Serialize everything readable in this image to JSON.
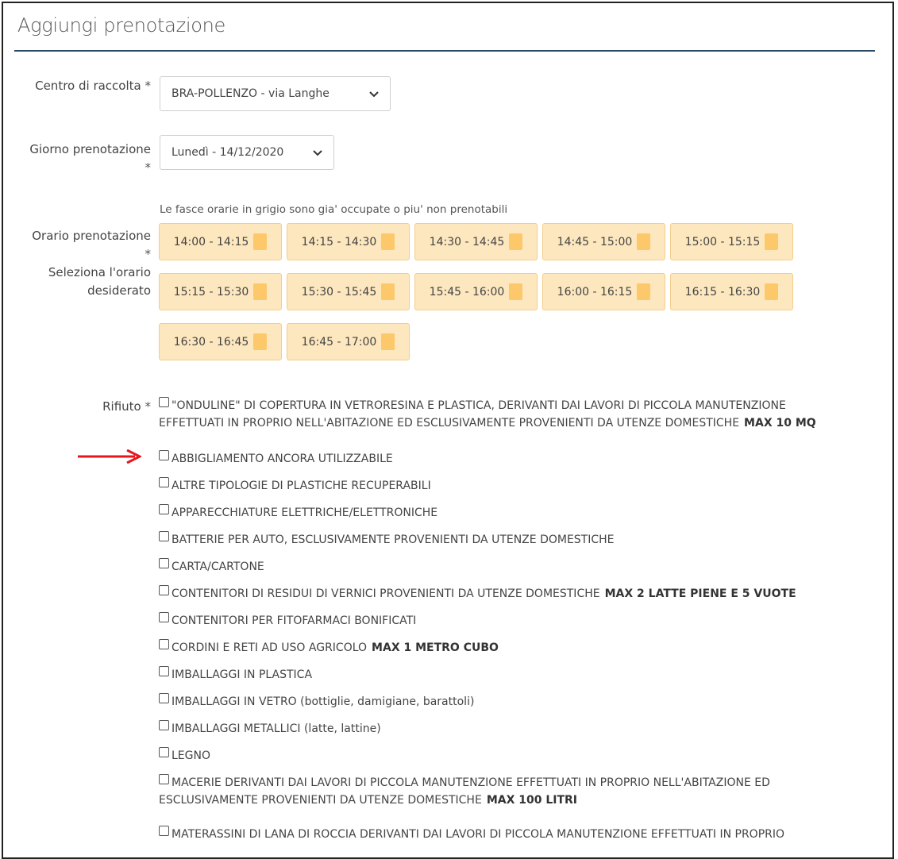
{
  "form": {
    "title": "Aggiungi prenotazione",
    "centro": {
      "label": "Centro di raccolta",
      "required_mark": "*",
      "value": "BRA-POLLENZO - via Langhe"
    },
    "giorno": {
      "label": "Giorno prenotazione",
      "required_mark": "*",
      "value": "Lunedì - 14/12/2020"
    },
    "orario": {
      "label": "Orario prenotazione",
      "required_mark": "*",
      "sublabel_line1": "Seleziona l'orario",
      "sublabel_line2": "desiderato",
      "hint": "Le fasce orarie in grigio sono gia' occupate o piu' non prenotabili",
      "slots": [
        "14:00 - 14:15",
        "14:15 - 14:30",
        "14:30 - 14:45",
        "14:45 - 15:00",
        "15:00 - 15:15",
        "15:15 - 15:30",
        "15:30 - 15:45",
        "15:45 - 16:00",
        "16:00 - 16:15",
        "16:15 - 16:30",
        "16:30 - 16:45",
        "16:45 - 17:00"
      ]
    },
    "rifiuto": {
      "label": "Rifiuto",
      "required_mark": "*",
      "items": [
        {
          "line1": "\"ONDULINE\" DI COPERTURA IN VETRORESINA E PLASTICA, DERIVANTI DAI LAVORI DI PICCOLA MANUTENZIONE",
          "line2": "EFFETTUATI IN PROPRIO NELL'ABITAZIONE ED ESCLUSIVAMENTE PROVENIENTI DA UTENZE DOMESTICHE",
          "max": "MAX 10 MQ"
        },
        {
          "line1": "ABBIGLIAMENTO ANCORA UTILIZZABILE",
          "line2": "",
          "max": ""
        },
        {
          "line1": "ALTRE TIPOLOGIE DI PLASTICHE RECUPERABILI",
          "line2": "",
          "max": ""
        },
        {
          "line1": "APPARECCHIATURE ELETTRICHE/ELETTRONICHE",
          "line2": "",
          "max": ""
        },
        {
          "line1": "BATTERIE PER AUTO, ESCLUSIVAMENTE PROVENIENTI DA UTENZE DOMESTICHE",
          "line2": "",
          "max": ""
        },
        {
          "line1": "CARTA/CARTONE",
          "line2": "",
          "max": ""
        },
        {
          "line1": "CONTENITORI DI RESIDUI DI VERNICI PROVENIENTI DA UTENZE DOMESTICHE",
          "line2": "",
          "max": "MAX 2 LATTE PIENE E 5 VUOTE"
        },
        {
          "line1": "CONTENITORI PER FITOFARMACI BONIFICATI",
          "line2": "",
          "max": ""
        },
        {
          "line1": "CORDINI E RETI AD USO AGRICOLO",
          "line2": "",
          "max": "MAX 1 METRO CUBO"
        },
        {
          "line1": "IMBALLAGGI IN PLASTICA",
          "line2": "",
          "max": ""
        },
        {
          "line1": "IMBALLAGGI IN VETRO (bottiglie, damigiane, barattoli)",
          "line2": "",
          "max": ""
        },
        {
          "line1": "IMBALLAGGI METALLICI (latte, lattine)",
          "line2": "",
          "max": ""
        },
        {
          "line1": "LEGNO",
          "line2": "",
          "max": ""
        },
        {
          "line1": "MACERIE DERIVANTI DAI LAVORI DI PICCOLA MANUTENZIONE EFFETTUATI IN PROPRIO NELL'ABITAZIONE ED",
          "line2": "ESCLUSIVAMENTE PROVENIENTI DA UTENZE DOMESTICHE",
          "max": "MAX 100 LITRI"
        },
        {
          "line1": "MATERASSINI DI LANA DI ROCCIA DERIVANTI DAI LAVORI DI PICCOLA MANUTENZIONE EFFETTUATI IN PROPRIO",
          "line2": "",
          "max": ""
        }
      ]
    }
  },
  "colors": {
    "slot_bg": "#fde7be",
    "slot_border": "#f4cd8a",
    "slot_square": "#fcc869",
    "heading_rule": "#2a4a66",
    "annotation_arrow": "#e8141c"
  }
}
